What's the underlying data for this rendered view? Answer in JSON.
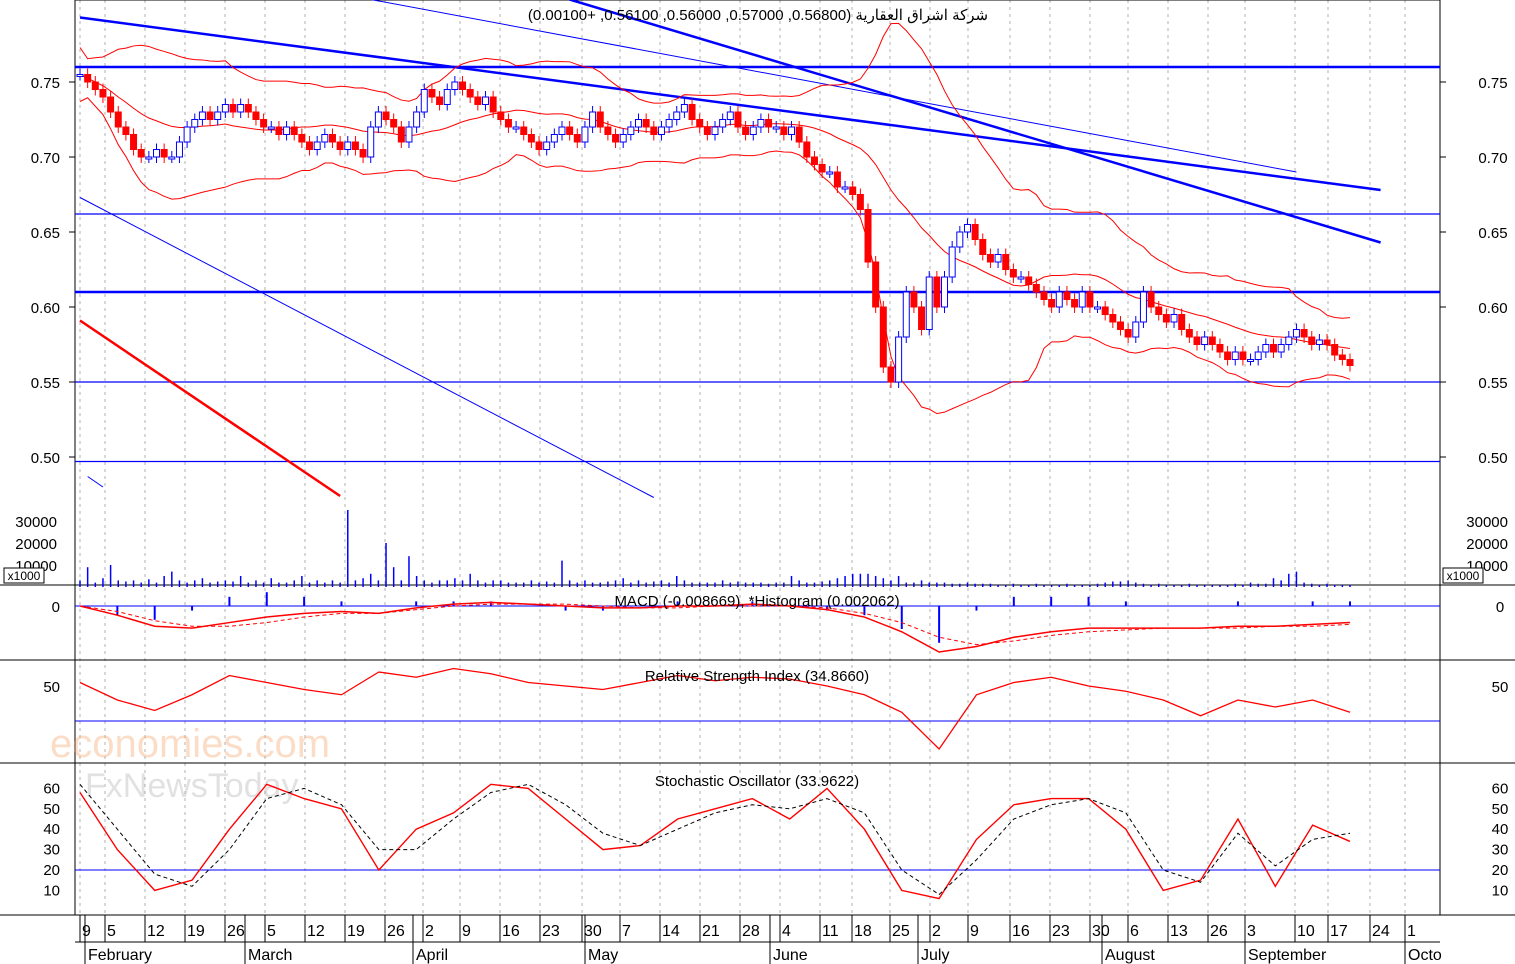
{
  "chart_data": {
    "type": "candlestick",
    "title": "شركة اشراق العقارية (0.56800, 0.57000, 0.56000, 0.56100, +0.00100)",
    "price_axis": {
      "ticks": [
        "0.75",
        "0.70",
        "0.65",
        "0.60",
        "0.55",
        "0.50"
      ],
      "values": [
        0.75,
        0.7,
        0.65,
        0.6,
        0.55,
        0.5
      ]
    },
    "volume_axis": {
      "ticks": [
        "30000",
        "20000",
        "10000"
      ],
      "values": [
        30000,
        20000,
        10000
      ],
      "unit_label": "x1000"
    },
    "closes": [
      0.755,
      0.75,
      0.745,
      0.74,
      0.73,
      0.72,
      0.715,
      0.705,
      0.7,
      0.7,
      0.705,
      0.7,
      0.7,
      0.71,
      0.72,
      0.725,
      0.73,
      0.725,
      0.73,
      0.735,
      0.73,
      0.735,
      0.73,
      0.725,
      0.72,
      0.72,
      0.715,
      0.72,
      0.715,
      0.71,
      0.705,
      0.71,
      0.715,
      0.71,
      0.705,
      0.71,
      0.705,
      0.7,
      0.72,
      0.73,
      0.725,
      0.72,
      0.71,
      0.72,
      0.73,
      0.745,
      0.74,
      0.735,
      0.745,
      0.75,
      0.745,
      0.74,
      0.735,
      0.74,
      0.73,
      0.725,
      0.72,
      0.72,
      0.715,
      0.71,
      0.705,
      0.71,
      0.715,
      0.72,
      0.715,
      0.71,
      0.72,
      0.73,
      0.72,
      0.715,
      0.71,
      0.715,
      0.72,
      0.725,
      0.72,
      0.715,
      0.72,
      0.725,
      0.73,
      0.735,
      0.725,
      0.72,
      0.715,
      0.72,
      0.725,
      0.73,
      0.72,
      0.715,
      0.72,
      0.725,
      0.72,
      0.72,
      0.715,
      0.72,
      0.71,
      0.7,
      0.695,
      0.69,
      0.69,
      0.68,
      0.68,
      0.675,
      0.665,
      0.63,
      0.6,
      0.56,
      0.55,
      0.58,
      0.61,
      0.6,
      0.585,
      0.62,
      0.6,
      0.62,
      0.64,
      0.65,
      0.655,
      0.645,
      0.635,
      0.63,
      0.635,
      0.625,
      0.62,
      0.62,
      0.615,
      0.61,
      0.605,
      0.6,
      0.61,
      0.605,
      0.6,
      0.61,
      0.6,
      0.6,
      0.595,
      0.59,
      0.585,
      0.58,
      0.59,
      0.61,
      0.6,
      0.595,
      0.59,
      0.595,
      0.585,
      0.58,
      0.575,
      0.58,
      0.575,
      0.57,
      0.565,
      0.57,
      0.565,
      0.565,
      0.57,
      0.575,
      0.57,
      0.575,
      0.58,
      0.585,
      0.58,
      0.575,
      0.578,
      0.575,
      0.568,
      0.565,
      0.561
    ],
    "volumes": [
      3000,
      9000,
      2000,
      4000,
      10000,
      3000,
      2500,
      3000,
      2000,
      3500,
      2000,
      5000,
      7000,
      3000,
      2000,
      3000,
      4000,
      2000,
      2500,
      3000,
      2500,
      5000,
      2000,
      3000,
      2000,
      4000,
      2000,
      2000,
      3000,
      5000,
      2000,
      3000,
      2000,
      3000,
      2000,
      35000,
      3000,
      4000,
      6000,
      3000,
      20000,
      9000,
      3000,
      14000,
      5000,
      3000,
      2000,
      3000,
      3000,
      4000,
      3000,
      6000,
      3000,
      2000,
      3000,
      3000,
      2000,
      2000,
      2000,
      3000,
      2000,
      2500,
      2000,
      12000,
      3000,
      2000,
      3000,
      2000,
      2000,
      2500,
      3000,
      4000,
      2000,
      3000,
      2000,
      2500,
      3000,
      2000,
      5000,
      3000,
      2000,
      2000,
      2000,
      2000,
      3000,
      2000,
      2500,
      2000,
      2000,
      2000,
      1500,
      2000,
      2000,
      5000,
      3000,
      2000,
      2000,
      2500,
      3000,
      4000,
      5000,
      6000,
      6000,
      6000,
      5000,
      4000,
      3000,
      5000,
      2000,
      2000,
      3000,
      2000,
      2000,
      2000,
      1500,
      1500,
      2000,
      1500,
      1500,
      1500,
      1000,
      1000,
      1500,
      1000,
      1000,
      1500,
      1000,
      1000,
      1000,
      1500,
      1000,
      1000,
      1000,
      1500,
      2000,
      2500,
      2500,
      3000,
      2000,
      1500,
      1000,
      1500,
      1000,
      1000,
      1000,
      1500,
      1000,
      1000,
      1000,
      1000,
      1000,
      1500,
      1000,
      2000,
      1500,
      1500,
      4000,
      3000,
      6000,
      7000,
      2000,
      1500,
      1000,
      1500,
      1000,
      1000,
      1000
    ],
    "support_resistance": [
      0.76,
      0.662,
      0.61,
      0.55,
      0.497
    ],
    "trendlines": [
      {
        "from": [
          0,
          0.793
        ],
        "to": [
          170,
          0.678
        ],
        "weight": "thick",
        "color": "#0000ff"
      },
      {
        "from": [
          64,
          0.805
        ],
        "to": [
          170,
          0.643
        ],
        "weight": "thick",
        "color": "#0000ff"
      },
      {
        "from": [
          38,
          0.805
        ],
        "to": [
          159,
          0.69
        ],
        "weight": "thin",
        "color": "#0000ff"
      },
      {
        "from": [
          0,
          0.673
        ],
        "to": [
          75,
          0.473
        ],
        "weight": "thin",
        "color": "#0000ff"
      },
      {
        "from": [
          1,
          0.487
        ],
        "to": [
          3,
          0.48
        ],
        "weight": "thin",
        "color": "#0000ff"
      },
      {
        "from": [
          0,
          0.591
        ],
        "to": [
          34,
          0.474
        ],
        "weight": "thick",
        "color": "#ff0000"
      }
    ],
    "macd": {
      "label": "MACD (-0.008669), *Histogram (0.002062)",
      "zero_label": "0",
      "macd": [
        0,
        -0.005,
        -0.011,
        -0.012,
        -0.009,
        -0.006,
        -0.004,
        -0.003,
        -0.004,
        -0.001,
        0.001,
        0.002,
        0.001,
        0,
        -0.001,
        -0.001,
        0,
        0,
        0.001,
        0,
        -0.002,
        -0.006,
        -0.014,
        -0.025,
        -0.022,
        -0.017,
        -0.014,
        -0.012,
        -0.012,
        -0.012,
        -0.012,
        -0.011,
        -0.011,
        -0.01,
        -0.009
      ],
      "signal": [
        0,
        -0.003,
        -0.008,
        -0.011,
        -0.011,
        -0.009,
        -0.006,
        -0.004,
        -0.004,
        -0.002,
        0,
        0.001,
        0.001,
        0.001,
        0,
        -0.001,
        -0.001,
        0,
        0,
        0,
        -0.001,
        -0.004,
        -0.009,
        -0.017,
        -0.021,
        -0.019,
        -0.016,
        -0.014,
        -0.013,
        -0.012,
        -0.012,
        -0.012,
        -0.011,
        -0.011,
        -0.01
      ]
    },
    "rsi": {
      "label": "Relative Strength Index (34.8660)",
      "tick": "50",
      "values": [
        52,
        42,
        36,
        45,
        56,
        52,
        48,
        45,
        58,
        55,
        60,
        57,
        52,
        50,
        48,
        52,
        56,
        53,
        55,
        54,
        50,
        45,
        35,
        14,
        45,
        52,
        55,
        50,
        47,
        42,
        33,
        42,
        38,
        42,
        35
      ]
    },
    "stochastic": {
      "label": "Stochastic Oscillator (33.9622)",
      "ticks": [
        "60",
        "50",
        "40",
        "30",
        "20",
        "10"
      ],
      "k": [
        58,
        30,
        10,
        15,
        40,
        62,
        55,
        50,
        20,
        40,
        48,
        62,
        60,
        45,
        30,
        32,
        45,
        50,
        55,
        45,
        60,
        40,
        10,
        6,
        35,
        52,
        55,
        55,
        40,
        10,
        15,
        45,
        12,
        42,
        34
      ],
      "d": [
        62,
        40,
        18,
        12,
        30,
        55,
        60,
        52,
        30,
        30,
        45,
        58,
        62,
        52,
        38,
        32,
        40,
        48,
        52,
        50,
        55,
        48,
        20,
        8,
        25,
        45,
        52,
        55,
        48,
        20,
        14,
        38,
        22,
        35,
        38
      ]
    },
    "x_axis": {
      "day_labels": [
        "9",
        "5",
        "12",
        "19",
        "26",
        "5",
        "12",
        "19",
        "26",
        "2",
        "9",
        "16",
        "23",
        "30",
        "7",
        "14",
        "21",
        "28",
        "4",
        "11",
        "18",
        "25",
        "2",
        "9",
        "16",
        "23",
        "30",
        "6",
        "13",
        "26",
        "3",
        "10",
        "17",
        "24",
        "1"
      ],
      "month_labels": [
        "February",
        "March",
        "April",
        "May",
        "June",
        "July",
        "August",
        "September",
        "Octo"
      ]
    },
    "watermark": [
      "economies.com",
      "FxNewsToday"
    ],
    "colors": {
      "up": "#0000ff",
      "down": "#ff0000",
      "band": "#ff0000",
      "line": "#0000ff"
    }
  }
}
